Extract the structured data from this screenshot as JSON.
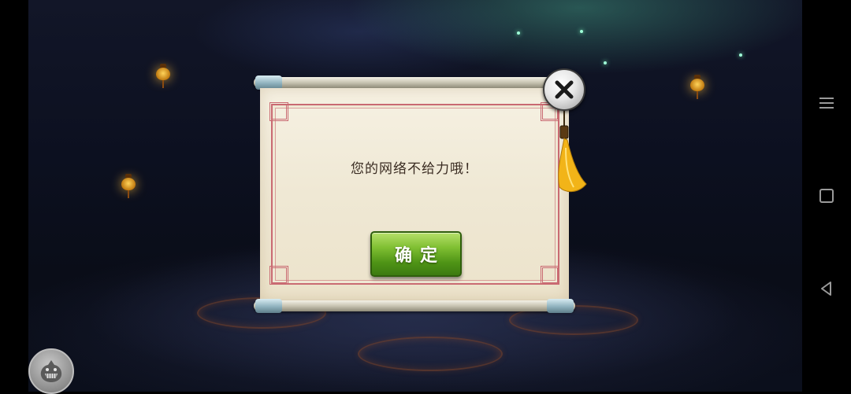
{
  "dialog": {
    "message": "您的网络不给力哦！",
    "confirm_label": "确定"
  },
  "icons": {
    "close": "close-icon",
    "chat": "chat-avatar-icon",
    "nav_menu": "menu-icon",
    "nav_home": "home-square-icon",
    "nav_back": "back-triangle-icon"
  },
  "colors": {
    "confirm_button": "#5fa31c",
    "frame_border": "#c96a72",
    "paper": "#f2ecdb",
    "message_text": "#3a2c22"
  }
}
